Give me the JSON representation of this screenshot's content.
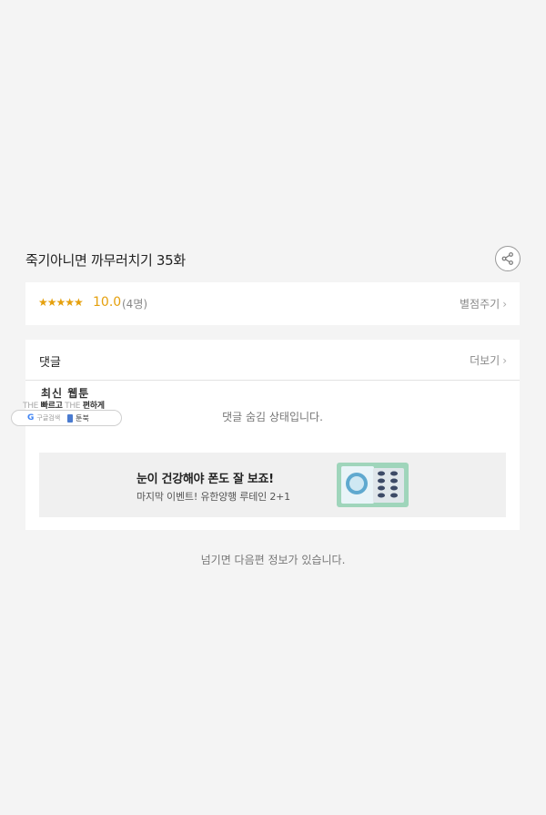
{
  "episode": {
    "title": "죽기아니면 까무러치기 35화"
  },
  "share": {
    "icon": "share-icon"
  },
  "rating": {
    "stars": "★★★★★",
    "score": "10.0",
    "count": "(4명)",
    "rate_label": "별점주기",
    "chevron": "›"
  },
  "comments": {
    "title": "댓글",
    "more_label": "더보기",
    "chevron": "›",
    "hidden_message": "댓글 숨김 상태입니다."
  },
  "ad": {
    "headline": "눈이 건강해야 폰도 잘 보죠!",
    "subtext": "마지막 이벤트! 유한양행 루테인 2+1",
    "image": "lutein-product-image"
  },
  "next_info": "넘기면 다음편 정보가 있습니다.",
  "overlay": {
    "title": "최신 웹툰",
    "tagline_the1": "THE",
    "tagline_fast": "빠르고",
    "tagline_the2": "THE",
    "tagline_easy": "편하게",
    "google_letter": "G",
    "google_search": "구글검색",
    "book_label": "툰북"
  },
  "colors": {
    "accent": "#e5a00d",
    "background": "#f4f4f4"
  }
}
